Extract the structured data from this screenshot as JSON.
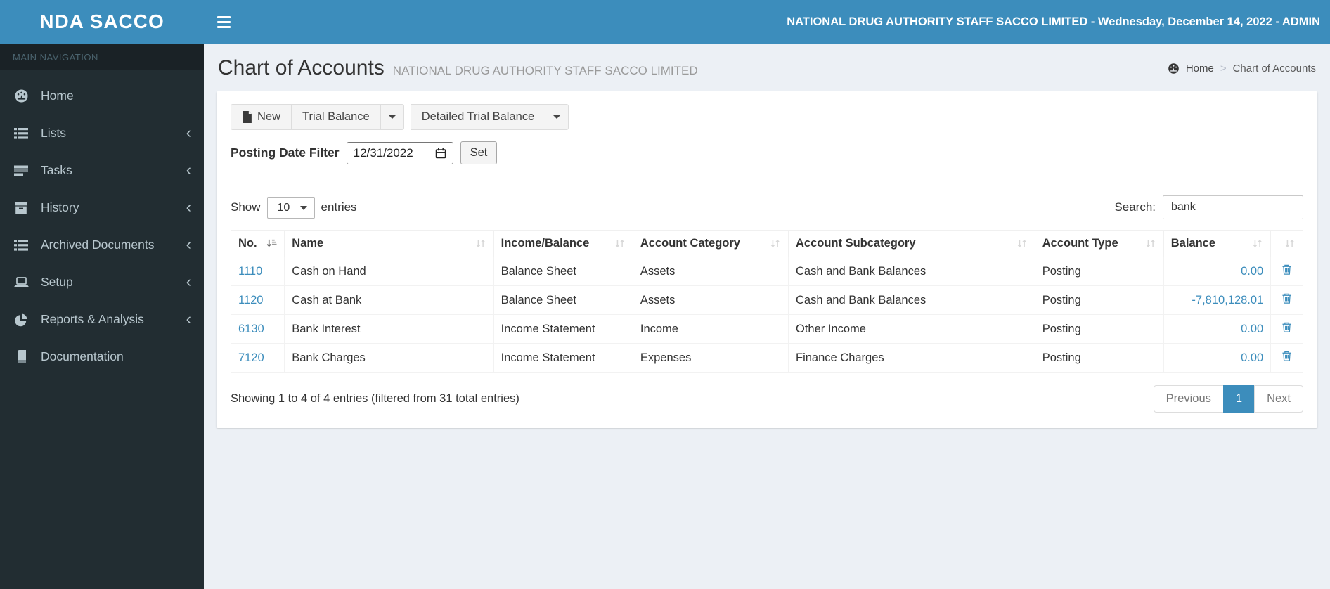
{
  "brand": {
    "logo": "NDA SACCO"
  },
  "header": {
    "title_bar": "NATIONAL DRUG AUTHORITY STAFF SACCO LIMITED - Wednesday, December 14, 2022 - ADMIN"
  },
  "sidebar": {
    "section_label": "MAIN NAVIGATION",
    "items": [
      {
        "label": "Home",
        "icon": "dashboard-icon",
        "has_submenu": false
      },
      {
        "label": "Lists",
        "icon": "list-icon",
        "has_submenu": true
      },
      {
        "label": "Tasks",
        "icon": "tasks-icon",
        "has_submenu": true
      },
      {
        "label": "History",
        "icon": "archive-icon",
        "has_submenu": true
      },
      {
        "label": "Archived Documents",
        "icon": "list-icon",
        "has_submenu": true
      },
      {
        "label": "Setup",
        "icon": "laptop-icon",
        "has_submenu": true
      },
      {
        "label": "Reports & Analysis",
        "icon": "pie-chart-icon",
        "has_submenu": true
      },
      {
        "label": "Documentation",
        "icon": "book-icon",
        "has_submenu": false
      }
    ]
  },
  "page": {
    "title": "Chart of Accounts",
    "subtitle": "NATIONAL DRUG AUTHORITY STAFF SACCO LIMITED",
    "breadcrumb": {
      "home": "Home",
      "separator": ">",
      "current": "Chart of Accounts"
    }
  },
  "toolbar": {
    "new_label": "New",
    "trial_balance_label": "Trial Balance",
    "detailed_trial_balance_label": "Detailed Trial Balance"
  },
  "date_filter": {
    "label": "Posting Date Filter",
    "value": "12/31/2022",
    "set_label": "Set"
  },
  "table_controls": {
    "show_label": "Show",
    "page_length": "10",
    "entries_label": "entries",
    "search_label": "Search:",
    "search_value": "bank"
  },
  "table": {
    "columns": [
      {
        "label": "No.",
        "sorted": "asc"
      },
      {
        "label": "Name",
        "sorted": "none"
      },
      {
        "label": "Income/Balance",
        "sorted": "none"
      },
      {
        "label": "Account Category",
        "sorted": "none"
      },
      {
        "label": "Account Subcategory",
        "sorted": "none"
      },
      {
        "label": "Account Type",
        "sorted": "none"
      },
      {
        "label": "Balance",
        "sorted": "none"
      },
      {
        "label": "",
        "sorted": "none"
      }
    ],
    "rows": [
      {
        "no": "1110",
        "name": "Cash on Hand",
        "income_balance": "Balance Sheet",
        "category": "Assets",
        "subcategory": "Cash and Bank Balances",
        "type": "Posting",
        "balance": "0.00"
      },
      {
        "no": "1120",
        "name": "Cash at Bank",
        "income_balance": "Balance Sheet",
        "category": "Assets",
        "subcategory": "Cash and Bank Balances",
        "type": "Posting",
        "balance": "-7,810,128.01"
      },
      {
        "no": "6130",
        "name": "Bank Interest",
        "income_balance": "Income Statement",
        "category": "Income",
        "subcategory": "Other Income",
        "type": "Posting",
        "balance": "0.00"
      },
      {
        "no": "7120",
        "name": "Bank Charges",
        "income_balance": "Income Statement",
        "category": "Expenses",
        "subcategory": "Finance Charges",
        "type": "Posting",
        "balance": "0.00"
      }
    ],
    "summary": "Showing 1 to 4 of 4 entries (filtered from 31 total entries)"
  },
  "pagination": {
    "previous": "Previous",
    "page": "1",
    "next": "Next"
  },
  "colors": {
    "accent": "#3c8dbc",
    "sidebar_bg": "#222d32",
    "content_bg": "#ecf0f5",
    "link": "#3c8dbc"
  }
}
